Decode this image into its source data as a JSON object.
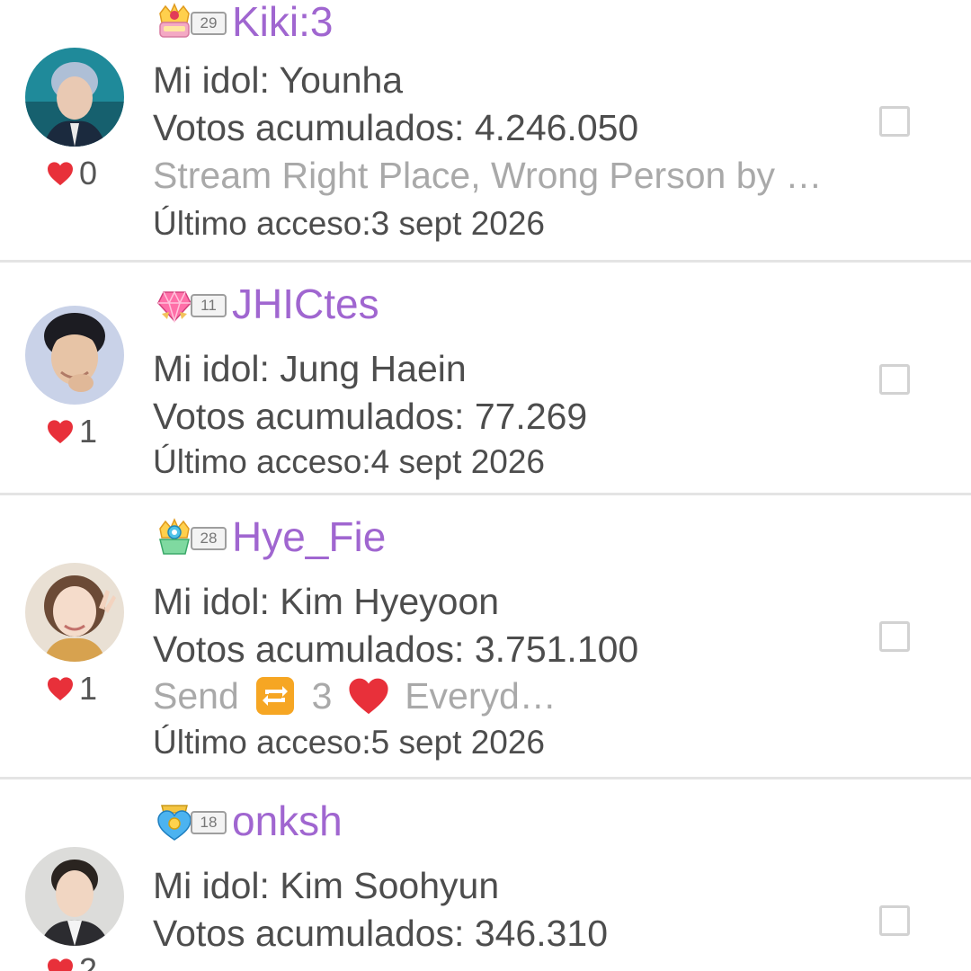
{
  "users": [
    {
      "name": "Kiki:3",
      "level": "29",
      "badge_icon": "crown-badge-icon",
      "idol_label": "Mi idol: Younha",
      "votes_label": "Votos acumulados: 4.246.050",
      "status": "Stream Right Place, Wrong Person by …",
      "last_access": "Último acceso:3 sept 2026",
      "likes": "0"
    },
    {
      "name": "JHICtes",
      "level": "11",
      "badge_icon": "heart-gem-badge-icon",
      "idol_label": "Mi idol: Jung Haein",
      "votes_label": "Votos acumulados: 77.269",
      "status": "",
      "last_access": "Último acceso:4 sept 2026",
      "likes": "1"
    },
    {
      "name": "Hye_Fie",
      "level": "28",
      "badge_icon": "crown-badge-icon",
      "idol_label": "Mi idol: Kim Hyeyoon",
      "votes_label": "Votos acumulados: 3.751.100",
      "status_parts": [
        "Send",
        "3",
        "Everyd…"
      ],
      "last_access": "Último acceso:5 sept 2026",
      "likes": "1"
    },
    {
      "name": "onksh",
      "level": "18",
      "badge_icon": "heart-shield-badge-icon",
      "idol_label": "Mi idol: Kim Soohyun",
      "votes_label": "Votos acumulados: 346.310",
      "status": "",
      "likes": "2"
    }
  ],
  "colors": {
    "username": "#a066d0",
    "text": "#4d4d4d",
    "status": "#a9a9a9",
    "heart": "#e8303a",
    "divider": "#e4e4e4"
  }
}
